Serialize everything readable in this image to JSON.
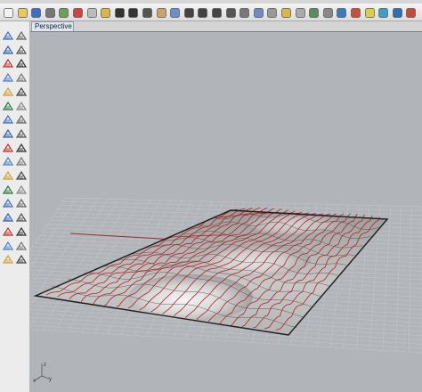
{
  "viewport": {
    "tab_label": "Perspective",
    "view_menu_icon": "triangle-down-icon",
    "axis_x_label": "x",
    "axis_y_label": "y",
    "axis_z_label": "z"
  },
  "toolbar_icons": [
    "new-file-icon",
    "open-file-icon",
    "save-icon",
    "print-icon",
    "import-icon",
    "cut-icon",
    "copy-icon",
    "paste-icon",
    "undo-icon",
    "redo-icon",
    "select-icon",
    "pan-icon",
    "rotate-view-icon",
    "zoom-icon",
    "zoom-window-icon",
    "zoom-extents-icon",
    "zoom-selected-icon",
    "viewport-layout-icon",
    "four-views-icon",
    "construction-plane-icon",
    "layer-icon",
    "properties-icon",
    "object-snap-icon",
    "wireframe-icon",
    "shaded-icon",
    "rendered-icon",
    "render-icon",
    "material-icon",
    "options-icon",
    "help-icon"
  ],
  "left_toolbar_icons": [
    "select-arrow-icon",
    "point-icon",
    "polyline-icon",
    "line-icon",
    "curve-icon",
    "rectangle-icon",
    "circle-icon",
    "arc-icon",
    "ellipse-icon",
    "polygon-icon",
    "freeform-icon",
    "fillet-icon",
    "surface-icon",
    "extrude-icon",
    "sweep-icon",
    "loft-icon",
    "box-icon",
    "sphere-icon",
    "mesh-icon",
    "boolean-icon",
    "transform-icon",
    "move-icon",
    "array-icon",
    "trim-icon",
    "split-icon",
    "join-icon",
    "explode-icon",
    "group-icon",
    "dimension-icon",
    "text-icon",
    "analyze-icon",
    "render-icon",
    "check-icon",
    "paint-icon"
  ]
}
